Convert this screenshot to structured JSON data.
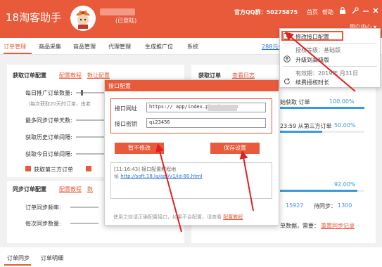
{
  "app": {
    "title": "18淘客助手",
    "login_status": "(已登陆)",
    "qq_label": "官方QQ群：50275875",
    "home": "首页",
    "help": "帮助",
    "user_center": "用户中心 ▾"
  },
  "nav": {
    "tabs": [
      "订单管理",
      "商品采集",
      "商品管理",
      "代理管理",
      "生成推广位",
      "系统"
    ],
    "extra": "288元会"
  },
  "left": {
    "fetch_title": "获取订单配置",
    "fetch_link1": "配置教程",
    "fetch_link2": "数让配置",
    "rows": [
      "每日推广订单数量:",
      "（每次获取20天的订单，由老",
      "最多同步订单天数:",
      "获取历史订单间隔:",
      "获取今日订单间隔:"
    ],
    "check1": "获取第三方订单",
    "sync_title": "同步订单配置",
    "sync_link1": "配置教程",
    "sync_link2": "数",
    "sync_rows": [
      "订单同步频率:",
      "每次同步数量:"
    ]
  },
  "right": {
    "title": "获取订单",
    "link": "查看日志",
    "line1": "始获取 订单",
    "pct1": "100.00%",
    "progress1": 1.0,
    "line2": "23:59 从第三方订单",
    "pct2": "50.00%",
    "progress2": 0.5,
    "pct3": "92.00%",
    "progress3": 0.92,
    "num1": "15927",
    "pending_label": "待同步：",
    "pending_value": "1300",
    "line4": "单数据，需要：",
    "line4_link": "重置同步记录"
  },
  "bottom": {
    "tabs": [
      "订单同步",
      "订单明细"
    ]
  },
  "dialog": {
    "title": "接口配置",
    "url_label": "接口网址",
    "url_value": "https://                      app/index.php?i=11&c=",
    "key_label": "接口密钥",
    "key_value": "qi23456",
    "btn_cancel": "暂不修改",
    "btn_save": "保存设置",
    "log_time": "[11:16:43] 接口配置教程地",
    "log_addr_prefix": "址 ",
    "log_link": "http://soft.18.la/api/v1/id-80.html",
    "footer_text": "使用之前请正确配置接口，如果不会配置，请查看",
    "footer_link": "配置教程"
  },
  "menu": {
    "items": [
      {
        "icon": "edit-icon",
        "label": "修改接口配置"
      },
      {
        "icon": "none",
        "label": "授权等级：基础版"
      },
      {
        "icon": "arrow-up-circle-icon",
        "label": "升级到高级版"
      },
      {
        "icon": "none",
        "label": "有效期：2019年  月31日"
      },
      {
        "icon": "refresh-icon",
        "label": "续费授权时长"
      }
    ]
  },
  "colors": {
    "accent": "#e85a3a",
    "link": "#2a6fd4",
    "progress": "#3a9ad9"
  }
}
